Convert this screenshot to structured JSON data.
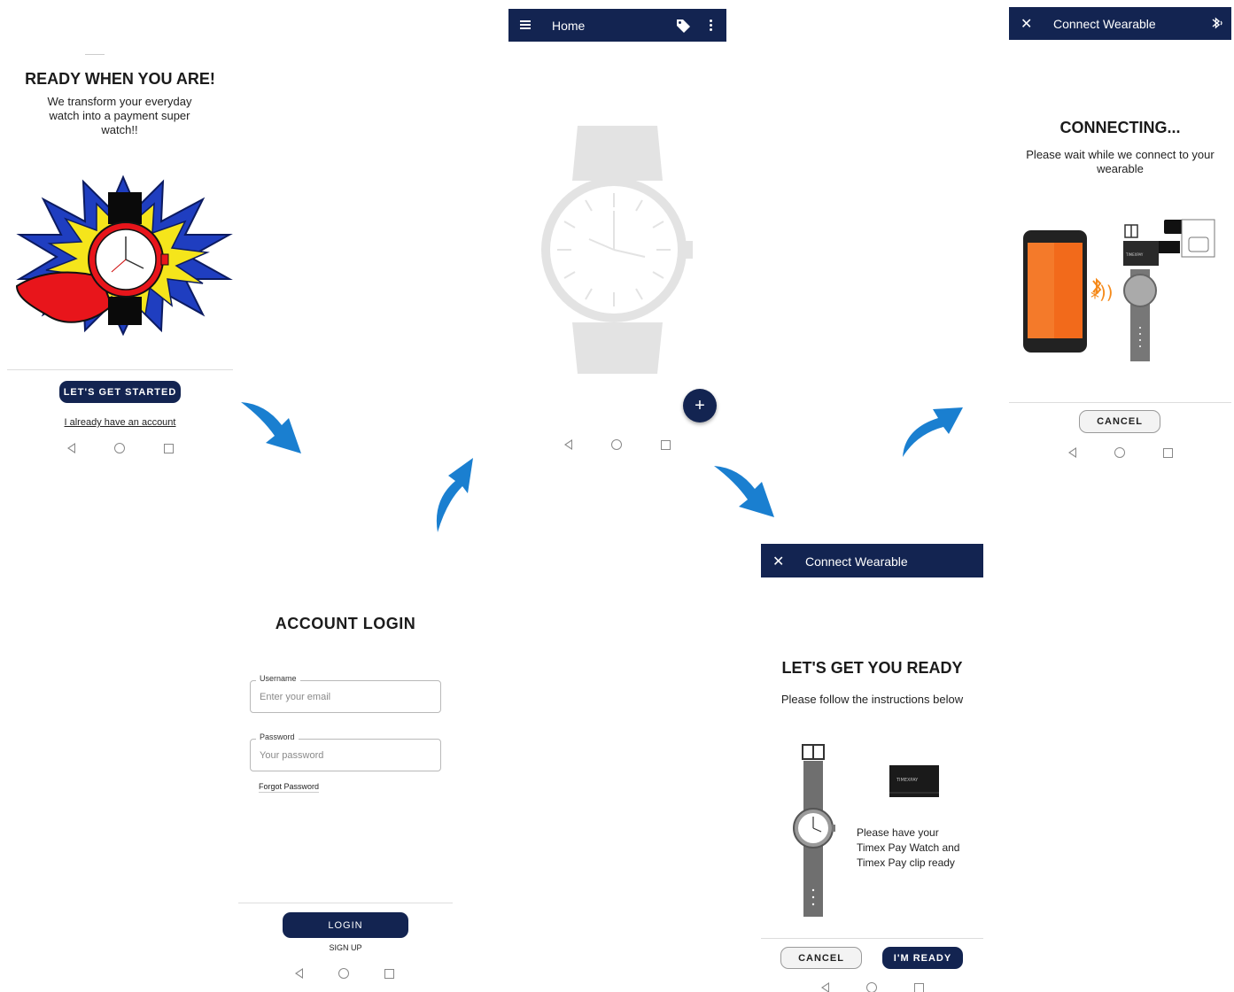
{
  "colors": {
    "navy": "#132451",
    "arrow_blue": "#1a7fd0"
  },
  "welcome": {
    "headline": "READY WHEN YOU ARE!",
    "tagline": "We transform your everyday watch into a payment super watch!!",
    "primary_button": "LET'S GET STARTED",
    "account_link": "I already have an account",
    "illustration_icon": "superhero-watch-icon"
  },
  "home": {
    "title": "Home",
    "menu_icon": "hamburger-icon",
    "tag_icon": "tag-icon",
    "more_icon": "more-vert-icon",
    "fab_label": "+",
    "watch_icon": "watch-placeholder-icon"
  },
  "connecting": {
    "title": "Connect Wearable",
    "close_icon": "close-icon",
    "bluetooth_icon": "bluetooth-icon",
    "headline": "CONNECTING...",
    "message": "Please wait while we connect to your wearable",
    "cancel_button": "CANCEL",
    "clip_brand": "TIMEXPAY"
  },
  "login": {
    "headline": "ACCOUNT LOGIN",
    "username_label": "Username",
    "username_placeholder": "Enter your email",
    "password_label": "Password",
    "password_placeholder": "Your password",
    "forgot_link": "Forgot Password",
    "login_button": "LOGIN",
    "signup_link": "SIGN UP"
  },
  "ready": {
    "title": "Connect Wearable",
    "close_icon": "close-icon",
    "headline": "LET'S GET YOU READY",
    "instruction": "Please follow the instructions below",
    "note_line1": "Please have your",
    "note_line2": "Timex Pay Watch and",
    "note_line3": "Timex Pay clip ready",
    "clip_brand": "TIMEXPAY",
    "cancel_button": "CANCEL",
    "ready_button": "I'M READY"
  }
}
